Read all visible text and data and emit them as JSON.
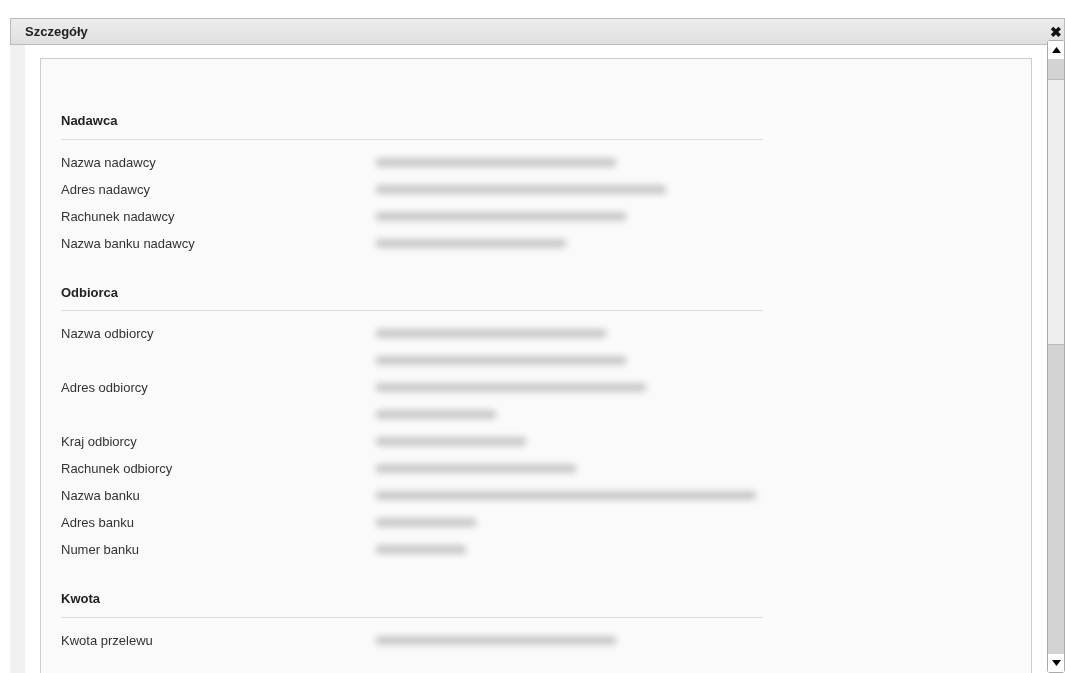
{
  "dialog": {
    "title": "Szczegóły",
    "close": "✖"
  },
  "sections": [
    {
      "heading": "Nadawca",
      "fields": [
        {
          "label": "Nazwa nadawcy",
          "value_lines": [
            {
              "redacted": true
            }
          ]
        },
        {
          "label": "Adres nadawcy",
          "value_lines": [
            {
              "redacted": true
            }
          ]
        },
        {
          "label": "Rachunek nadawcy",
          "value_lines": [
            {
              "redacted": true
            }
          ]
        },
        {
          "label": "Nazwa banku nadawcy",
          "value_lines": [
            {
              "redacted": true
            }
          ]
        }
      ]
    },
    {
      "heading": "Odbiorca",
      "fields": [
        {
          "label": "Nazwa odbiorcy",
          "value_lines": [
            {
              "redacted": true
            }
          ]
        },
        {
          "label": "Adres odbiorcy",
          "value_lines": [
            {
              "redacted": true
            },
            {
              "redacted": true
            },
            {
              "redacted": true
            }
          ]
        },
        {
          "label": "Kraj odbiorcy",
          "value_lines": [
            {
              "redacted": true
            }
          ]
        },
        {
          "label": "Rachunek odbiorcy",
          "value_lines": [
            {
              "redacted": true
            }
          ]
        },
        {
          "label": "Nazwa banku",
          "value_lines": [
            {
              "redacted": true
            }
          ]
        },
        {
          "label": "Adres banku",
          "value_lines": [
            {
              "redacted": true
            }
          ]
        },
        {
          "label": "Numer banku",
          "value_lines": [
            {
              "redacted": true
            }
          ]
        }
      ]
    },
    {
      "heading": "Kwota",
      "fields": [
        {
          "label": "Kwota przelewu",
          "value_lines": [
            {
              "redacted": true
            }
          ]
        }
      ]
    }
  ]
}
